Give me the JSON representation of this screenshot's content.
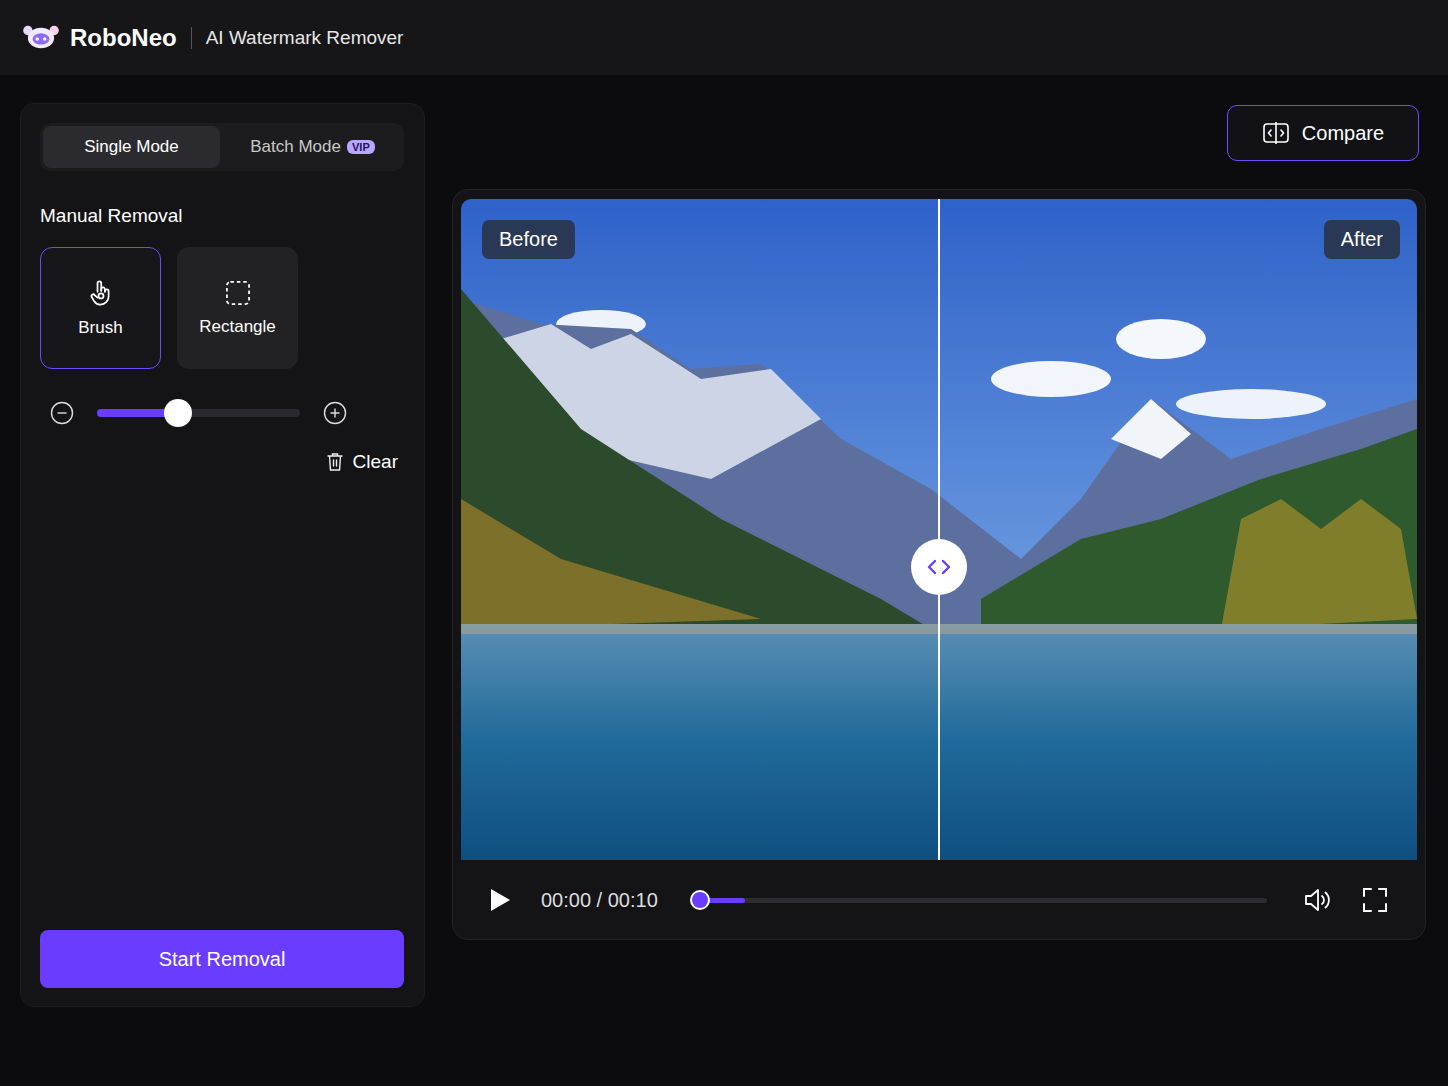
{
  "header": {
    "brand": "RoboNeo",
    "title": "AI Watermark Remover"
  },
  "modes": [
    {
      "label": "Single Mode",
      "selected": true
    },
    {
      "label": "Batch Mode",
      "selected": false,
      "badge": "VIP"
    }
  ],
  "manual_removal": {
    "title": "Manual Removal",
    "tools": [
      {
        "label": "Brush",
        "selected": true,
        "kind": "brush"
      },
      {
        "label": "Rectangle",
        "selected": false,
        "kind": "rectangle"
      }
    ],
    "brush_size": {
      "level": 0.4
    },
    "clear": "Clear"
  },
  "start_button": "Start Removal",
  "compare_button": "Compare",
  "preview": {
    "before_label": "Before",
    "after_label": "After",
    "split": 0.5
  },
  "player": {
    "time": "00:00 / 00:10",
    "playing": false,
    "progress": {
      "level": 0.016,
      "buffered": 0.094
    }
  }
}
